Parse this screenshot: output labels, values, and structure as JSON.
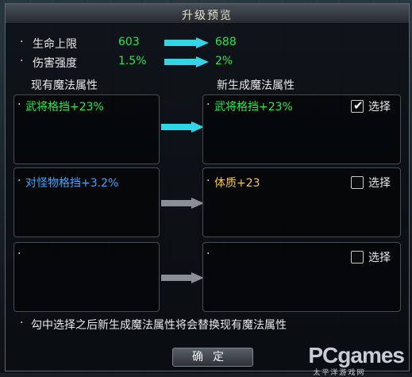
{
  "title": "升级预览",
  "stats": [
    {
      "label": "生命上限",
      "current": "603",
      "next": "688"
    },
    {
      "label": "伤害强度",
      "current": "1.5%",
      "next": "2%"
    }
  ],
  "headers": {
    "current": "现有魔法属性",
    "new": "新生成魔法属性"
  },
  "rows": [
    {
      "current": "武将格挡+23%",
      "current_color": "#26e84a",
      "new": "武将格挡+23%",
      "new_color": "#26e84a",
      "select_label": "选择",
      "checked": true
    },
    {
      "current": "对怪物格挡+3.2%",
      "current_color": "#3ea6ff",
      "new": "体质+23",
      "new_color": "#f0c94a",
      "select_label": "选择",
      "checked": false
    },
    {
      "current": "",
      "current_color": "#e9e9e9",
      "new": "",
      "new_color": "#e9e9e9",
      "select_label": "选择",
      "checked": false
    }
  ],
  "note": "勾中选择之后新生成魔法属性将会替换现有魔法属性",
  "confirm_label": "确定",
  "watermark": "PCgames",
  "watermark_sub": "太平洋游戏网",
  "colors": {
    "arrow_active": "#2fd6e8",
    "arrow_inactive": "#8a8f95"
  }
}
